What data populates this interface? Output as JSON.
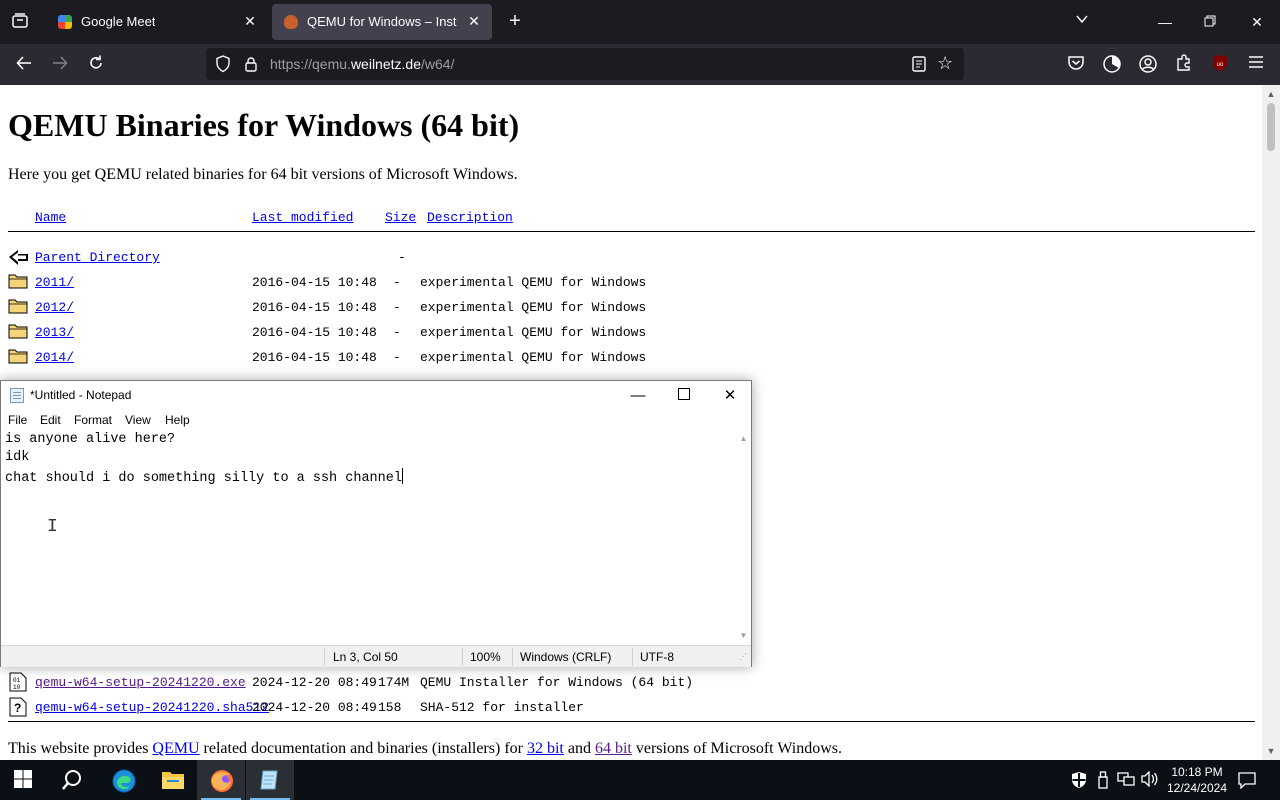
{
  "browser": {
    "tabs": [
      {
        "title": "Google Meet",
        "favicon": "google-meet-icon",
        "active": false
      },
      {
        "title": "QEMU for Windows – Installers",
        "favicon": "qemu-icon",
        "active": true
      }
    ],
    "url_prefix": "https://qemu.",
    "url_host": "weilnetz.de",
    "url_path": "/w64/"
  },
  "page": {
    "title": "QEMU Binaries for Windows (64 bit)",
    "intro": "Here you get QEMU related binaries for 64 bit versions of Microsoft Windows.",
    "headers": {
      "name": "Name",
      "modified": "Last modified",
      "size": "Size",
      "description": "Description"
    },
    "parent": {
      "name": "Parent Directory",
      "size": "-"
    },
    "rows": [
      {
        "name": "2011/",
        "modified": "2016-04-15 10:48",
        "size": "-",
        "description": "experimental QEMU for Windows",
        "icon": "folder-icon"
      },
      {
        "name": "2012/",
        "modified": "2016-04-15 10:48",
        "size": "-",
        "description": "experimental QEMU for Windows",
        "icon": "folder-icon"
      },
      {
        "name": "2013/",
        "modified": "2016-04-15 10:48",
        "size": "-",
        "description": "experimental QEMU for Windows",
        "icon": "folder-icon"
      },
      {
        "name": "2014/",
        "modified": "2016-04-15 10:48",
        "size": "-",
        "description": "experimental QEMU for Windows",
        "icon": "folder-icon"
      }
    ],
    "bottom_rows": [
      {
        "name": "qemu-w64-setup-20241220.exe",
        "modified": "2024-12-20 08:49",
        "size": "174M",
        "description": "QEMU Installer for Windows (64 bit)",
        "icon": "binary-file-icon"
      },
      {
        "name": "qemu-w64-setup-20241220.sha512",
        "modified": "2024-12-20 08:49",
        "size": "158",
        "description": "SHA-512 for installer",
        "icon": "unknown-file-icon"
      }
    ],
    "footer": {
      "prefix": "This website provides ",
      "link1": "QEMU",
      "middle": " related documentation and binaries (installers) for ",
      "link2": "32 bit",
      "and": " and ",
      "link3": "64 bit",
      "suffix": " versions of Microsoft Windows."
    }
  },
  "notepad": {
    "title": "*Untitled - Notepad",
    "menu": [
      "File",
      "Edit",
      "Format",
      "View",
      "Help"
    ],
    "lines": [
      "is anyone alive here?",
      "idk",
      "chat should i do something silly to a ssh channel"
    ],
    "status": {
      "position": "Ln 3, Col 50",
      "zoom": "100%",
      "line_ending": "Windows (CRLF)",
      "encoding": "UTF-8"
    }
  },
  "taskbar": {
    "apps": [
      "windows-start-icon",
      "search-icon",
      "edge-icon",
      "file-explorer-icon",
      "firefox-icon",
      "notepad-icon"
    ],
    "time": "10:18 PM",
    "date": "12/24/2024"
  },
  "colors": {
    "link": "#0000ee",
    "visited": "#551a8b",
    "chrome_dark": "#1c1b22",
    "active_tab": "#42414d",
    "taskbar": "#0b1016"
  }
}
